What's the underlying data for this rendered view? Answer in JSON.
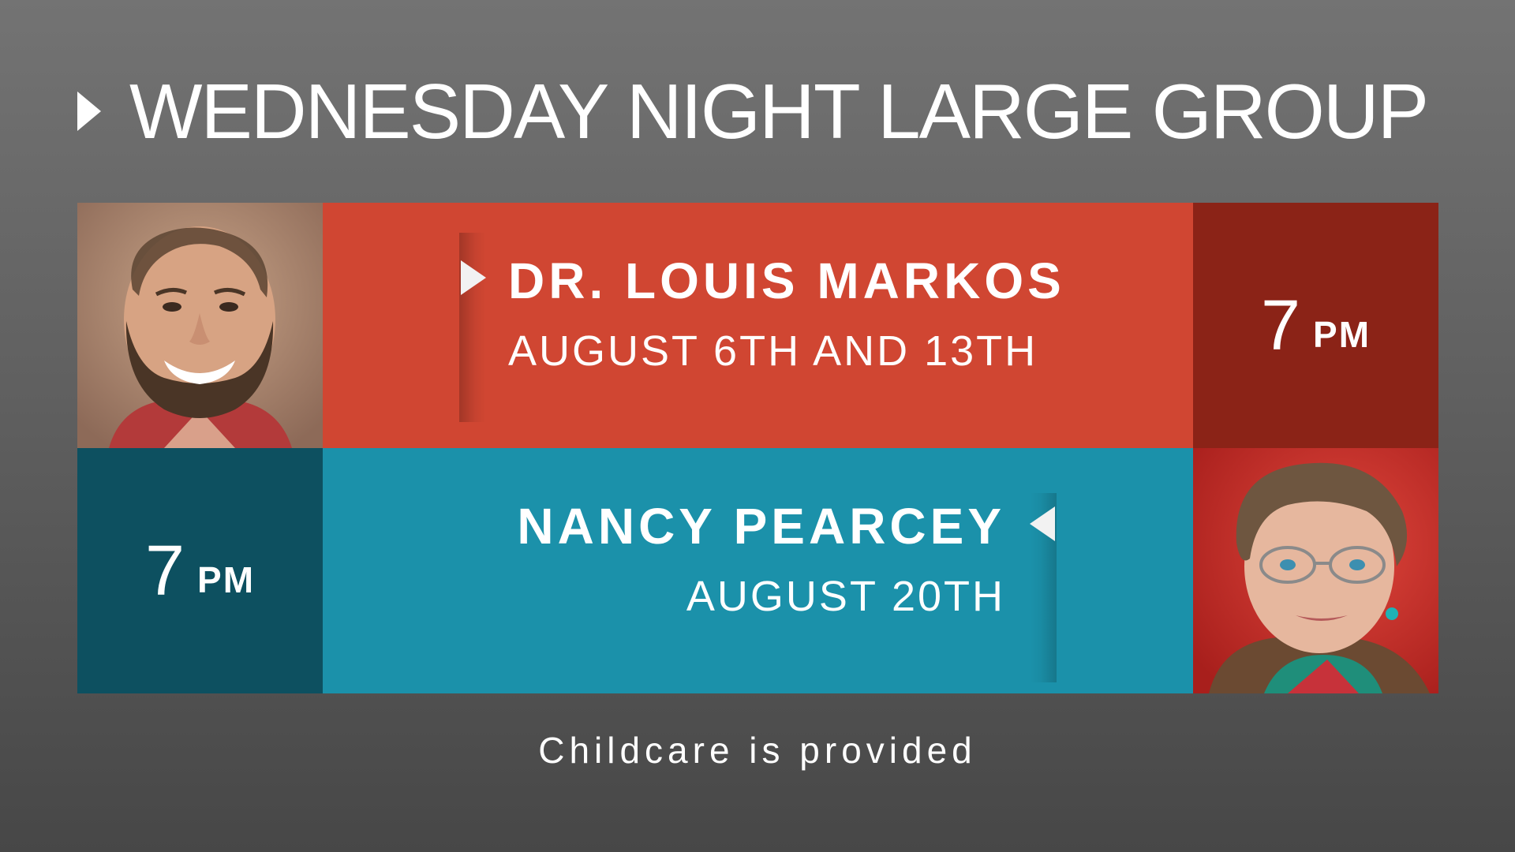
{
  "header": {
    "title": "WEDNESDAY NIGHT LARGE GROUP"
  },
  "speakers": [
    {
      "name": "DR. LOUIS MARKOS",
      "dates": "AUGUST 6TH AND 13TH",
      "time_number": "7",
      "time_unit": "PM",
      "band_color": "#d04632",
      "time_box_color": "#8b2317"
    },
    {
      "name": "NANCY PEARCEY",
      "dates": "AUGUST 20TH",
      "time_number": "7",
      "time_unit": "PM",
      "band_color": "#1b91aa",
      "time_box_color": "#0d5060"
    }
  ],
  "footer": {
    "note": "Childcare is provided"
  }
}
